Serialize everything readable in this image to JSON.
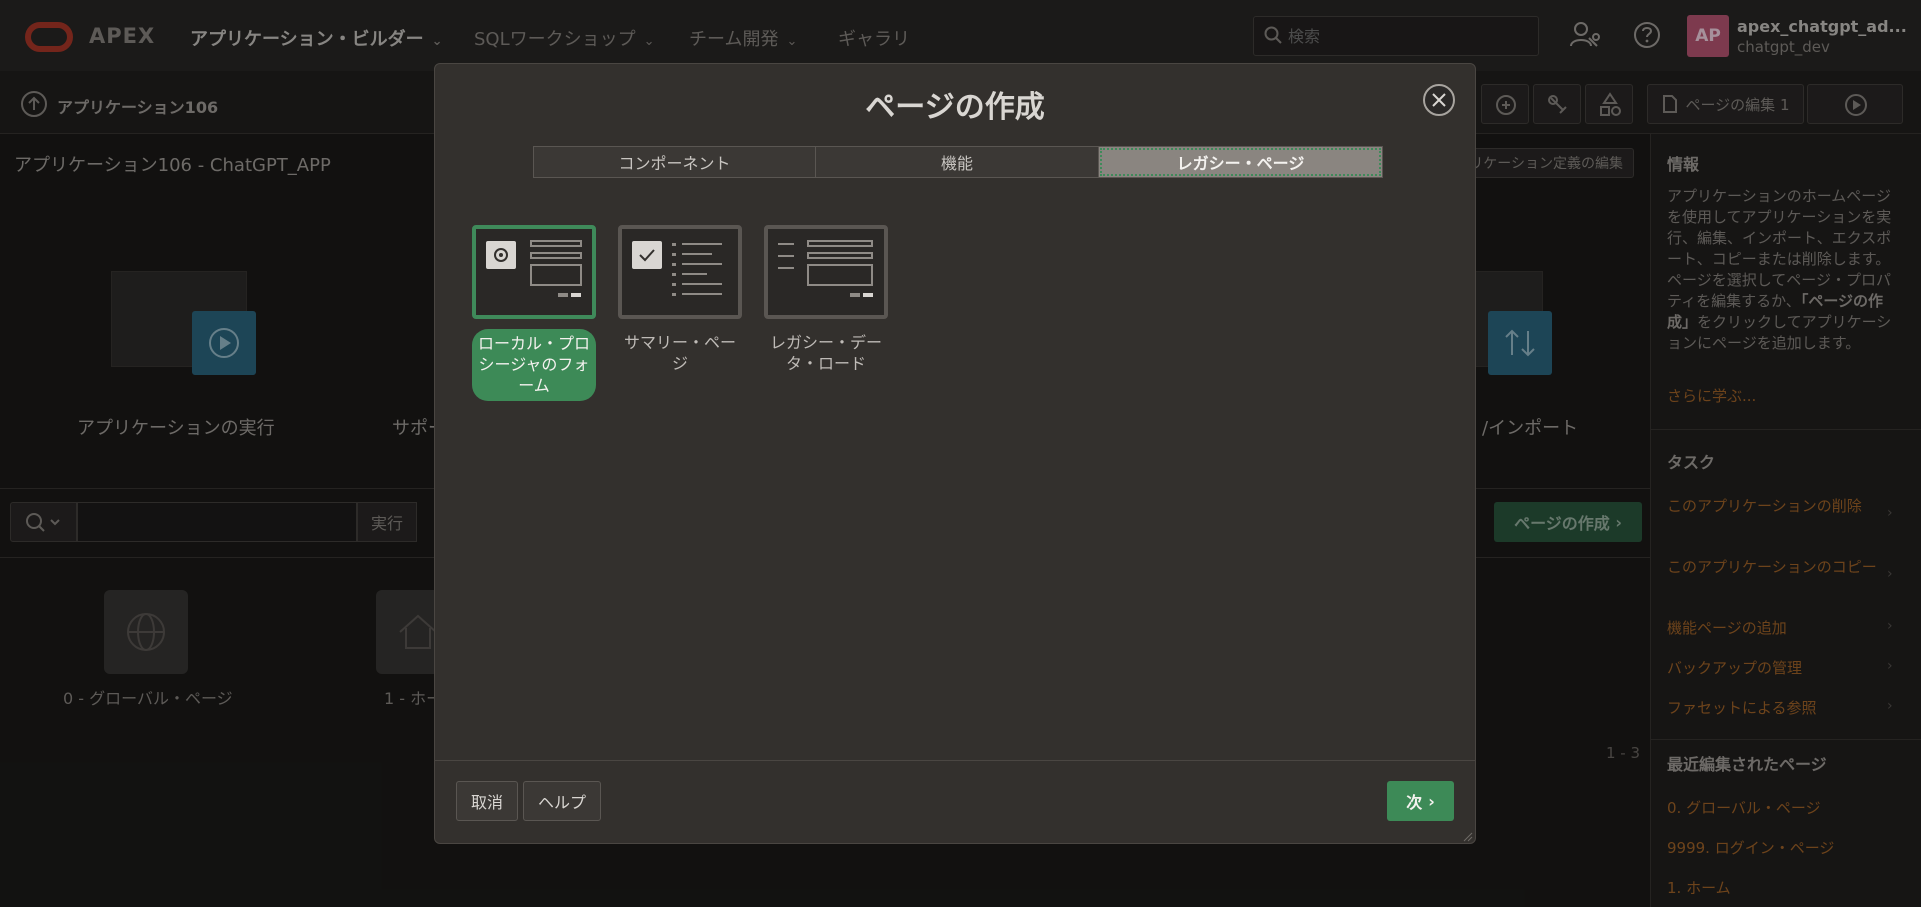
{
  "header": {
    "brand": "APEX",
    "nav": [
      {
        "label": "アプリケーション・ビルダー",
        "active": true,
        "has_menu": true
      },
      {
        "label": "SQLワークショップ",
        "active": false,
        "has_menu": true
      },
      {
        "label": "チーム開発",
        "active": false,
        "has_menu": true
      },
      {
        "label": "ギャラリ",
        "active": false,
        "has_menu": false
      }
    ],
    "search_placeholder": "検索",
    "avatar_initials": "AP",
    "user_name": "apex_chatgpt_ad...",
    "user_workspace": "chatgpt_dev"
  },
  "subbar": {
    "breadcrumb": "アプリケーション106",
    "edit_page_label": "ページの編集 1"
  },
  "main": {
    "app_title": "アプリケーション106 - ChatGPT_APP",
    "edit_definition_label": "リケーション定義の編集",
    "big_actions": [
      {
        "label": "アプリケーションの実行"
      },
      {
        "label": "サポー"
      },
      {
        "label": "/インポート"
      }
    ],
    "exec_label": "実行",
    "create_page_label": "ページの作成",
    "pages": [
      {
        "label": "0 - グローバル・ページ"
      },
      {
        "label": "1 - ホー"
      }
    ],
    "range": "1 - 3"
  },
  "sidebar": {
    "info_heading": "情報",
    "info_text_1": "アプリケーションのホームページを使用してアプリケーションを実行、編集、インポート、エクスポート、コピーまたは削除します。ページを選択してページ・プロパティを編集するか、",
    "info_text_bold": "「ページの作成」",
    "info_text_2": "をクリックしてアプリケーションにページを追加します。",
    "learn_more": "さらに学ぶ...",
    "tasks_heading": "タスク",
    "tasks": [
      {
        "label": "このアプリケーションの削除"
      },
      {
        "label": "このアプリケーションのコピー"
      },
      {
        "label": "機能ページの追加"
      },
      {
        "label": "バックアップの管理"
      },
      {
        "label": "ファセットによる参照"
      }
    ],
    "recent_heading": "最近編集されたページ",
    "recent": [
      {
        "label": "0. グローバル・ページ"
      },
      {
        "label": "9999. ログイン・ページ"
      },
      {
        "label": "1. ホーム"
      }
    ]
  },
  "dialog": {
    "title": "ページの作成",
    "tabs": [
      {
        "label": "コンポーネント",
        "active": false
      },
      {
        "label": "機能",
        "active": false
      },
      {
        "label": "レガシー・ページ",
        "active": true
      }
    ],
    "cards": [
      {
        "label": "ローカル・プロシージャのフォーム",
        "selected": true,
        "icon": "gear-icon"
      },
      {
        "label": "サマリー・ページ",
        "selected": false,
        "icon": "checkbox-icon"
      },
      {
        "label": "レガシー・データ・ロード",
        "selected": false,
        "icon": "list-icon"
      }
    ],
    "cancel_label": "取消",
    "help_label": "ヘルプ",
    "next_label": "次"
  },
  "colors": {
    "accent_green": "#3d8a57",
    "link_orange": "#a8682a",
    "brand_red": "#b33a2a",
    "avatar_pink": "#c05a78"
  }
}
